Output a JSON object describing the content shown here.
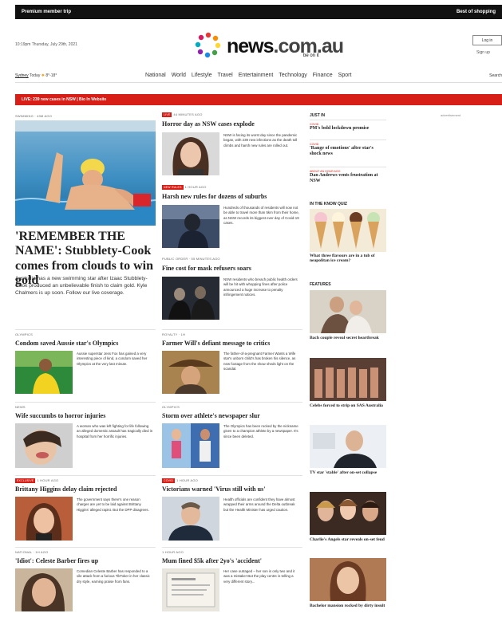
{
  "topbar": {
    "left": "Premium member trip",
    "right": "Best of shopping"
  },
  "header": {
    "date": "10:19pm Thursday, July 29th, 2021",
    "logo_word": "news",
    "logo_domain": ".com.au",
    "tagline": "be on it",
    "login": "Log in",
    "signup": "Sign up"
  },
  "location": {
    "city": "Sydney",
    "today": "Today",
    "temp": "8°-18°"
  },
  "nav": [
    "National",
    "World",
    "Lifestyle",
    "Travel",
    "Entertainment",
    "Technology",
    "Finance",
    "Sport"
  ],
  "search_label": "Search",
  "alert": "LIVE: 239 new cases in NSW | Bio In Website",
  "lead": {
    "kicker": "swimming · 43m ago",
    "title": "'REMEMBER THE NAME': Stubblety-Cook comes from clouds to win gold",
    "summary": "Australia has a new swimming star after Izaac Stubblety-Cook produced an unbelievable finish to claim gold. Kyle Chalmers is up soon. Follow our live coverage."
  },
  "mid_stories": [
    {
      "kicker": "44 minutes ago",
      "label": "LIVE",
      "title": "Horror day as NSW cases explode",
      "summary": "NSW is facing its worst day since the pandemic began, with 239 new infections as the death toll climbs and harsh new rules are rolled out."
    },
    {
      "kicker": "1 hour ago",
      "label": "NEW RULES",
      "title": "Harsh new rules for dozens of suburbs",
      "summary": "Hundreds of thousands of residents will now not be able to travel more than 5km from their home, as NSW records its biggest ever day of Covid-19 cases."
    },
    {
      "kicker": "public order · 55 minutes ago",
      "label": "",
      "title": "Fine cost for mask refusers soars",
      "summary": "NSW residents who breach public health orders will be hit with whopping fines after police announced a huge increase to penalty infringement notices."
    },
    {
      "kicker": "royalty · 1h",
      "label": "",
      "title": "Farmer Will's defiant message to critics",
      "summary": "The father-of-a-pregnant Farmer Wants a Wife star's unborn child's has broken his silence, as new footage from the show sheds light on the scandal."
    },
    {
      "kicker": "olympics",
      "label": "",
      "title": "Storm over athlete's newspaper slur",
      "summary": "The Olympics has been rocked by the nickname given to a champion athlete by a newspaper. It's since been deleted."
    },
    {
      "kicker": "1 hour ago",
      "label": "COVID",
      "title": "Victorians warned 'Virus still with us'",
      "summary": "Health officials are confident they have almost wrapped their arms around the Delta outbreak but the Health Minister has urged caution."
    },
    {
      "kicker": "1 hour ago",
      "label": "",
      "title": "Mum fined $5k after 2yo's 'accident'",
      "summary": "Her case outraged – her son is only two and it was a mistake! But the play centre is telling a very different story..."
    }
  ],
  "left_stories": [
    {
      "kicker": "olympics",
      "label": "",
      "title": "Condom saved Aussie star's Olympics",
      "summary": "Aussie superstar Jess Fox has gained a very interesting piece of kind, a condom saved her Olympics at the very last minute."
    },
    {
      "kicker": "news",
      "label": "",
      "title": "Wife succumbs to horror injuries",
      "summary": "A woman who was left fighting for life following an alleged domestic assault has tragically died in hospital from her horrific injuries."
    },
    {
      "kicker": "1 hour ago",
      "label": "EXCLUSIVE",
      "title": "Brittany Higgins delay claim rejected",
      "summary": "The government says there's one reason charges are yet to be laid against Brittany Higgins' alleged rapist. But the DPP disagrees."
    },
    {
      "kicker": "national · 1h ago",
      "label": "",
      "title": "'Idiot': Celeste Barber fires up",
      "summary": "Comedian Celeste Barber has responded to a vile attack from a furious TikToker in her classic dry style, earning praise from fans."
    }
  ],
  "just_in": {
    "heading": "JUST IN",
    "items": [
      {
        "kicker": "covid",
        "title": "PM's bold lockdown promise"
      },
      {
        "kicker": "covid",
        "title": "'Range of emotions' after star's shock news"
      },
      {
        "kicker": "about an hour ago",
        "title": "Dan Andrews vents frustration at NSW"
      }
    ]
  },
  "in_the_know": {
    "heading": "IN THE KNOW QUIZ",
    "caption": "What three flavours are in a tub of neapolitan ice cream?"
  },
  "features": {
    "heading": "FEATURES",
    "items": [
      "Bach couple reveal secret heartbreak",
      "Celebs forced to strip on SAS Australia",
      "TV star 'stable' after on-set collapse",
      "Charlie's Angels star reveals on-set feud",
      "Bachelor mansion rocked by dirty insult"
    ]
  },
  "advertisement": "advertisement",
  "colors": {
    "accent": "#d71e17",
    "topbar": "#111111"
  }
}
